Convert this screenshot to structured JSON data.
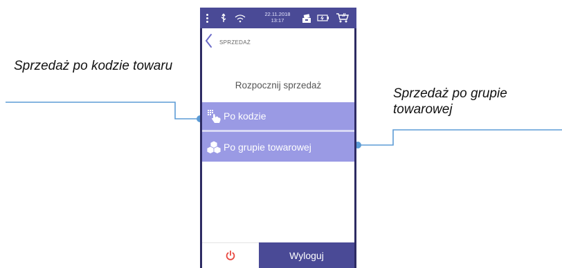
{
  "annotations": {
    "left_callout": "Sprzedaż po kodzie towaru",
    "right_callout": "Sprzedaż po grupie towarowej"
  },
  "status_bar": {
    "date": "22.11.2018",
    "time": "13:17",
    "icons": [
      "menu-dots-icon",
      "usb-icon",
      "wifi-icon",
      "cash-drawer-icon",
      "battery-icon",
      "cart-icon"
    ]
  },
  "screen": {
    "title": "SPRZEDAŻ",
    "heading": "Rozpocznij sprzedaż",
    "buttons": {
      "by_code": "Po kodzie",
      "by_group": "Po grupie towarowej"
    },
    "bottom": {
      "logout": "Wyloguj"
    }
  },
  "colors": {
    "status_bar": "#4a4a96",
    "menu_button": "#9a9ae4",
    "logout_button": "#4a4a96",
    "power_icon": "#e8473f",
    "connector": "#5b9bd5"
  }
}
